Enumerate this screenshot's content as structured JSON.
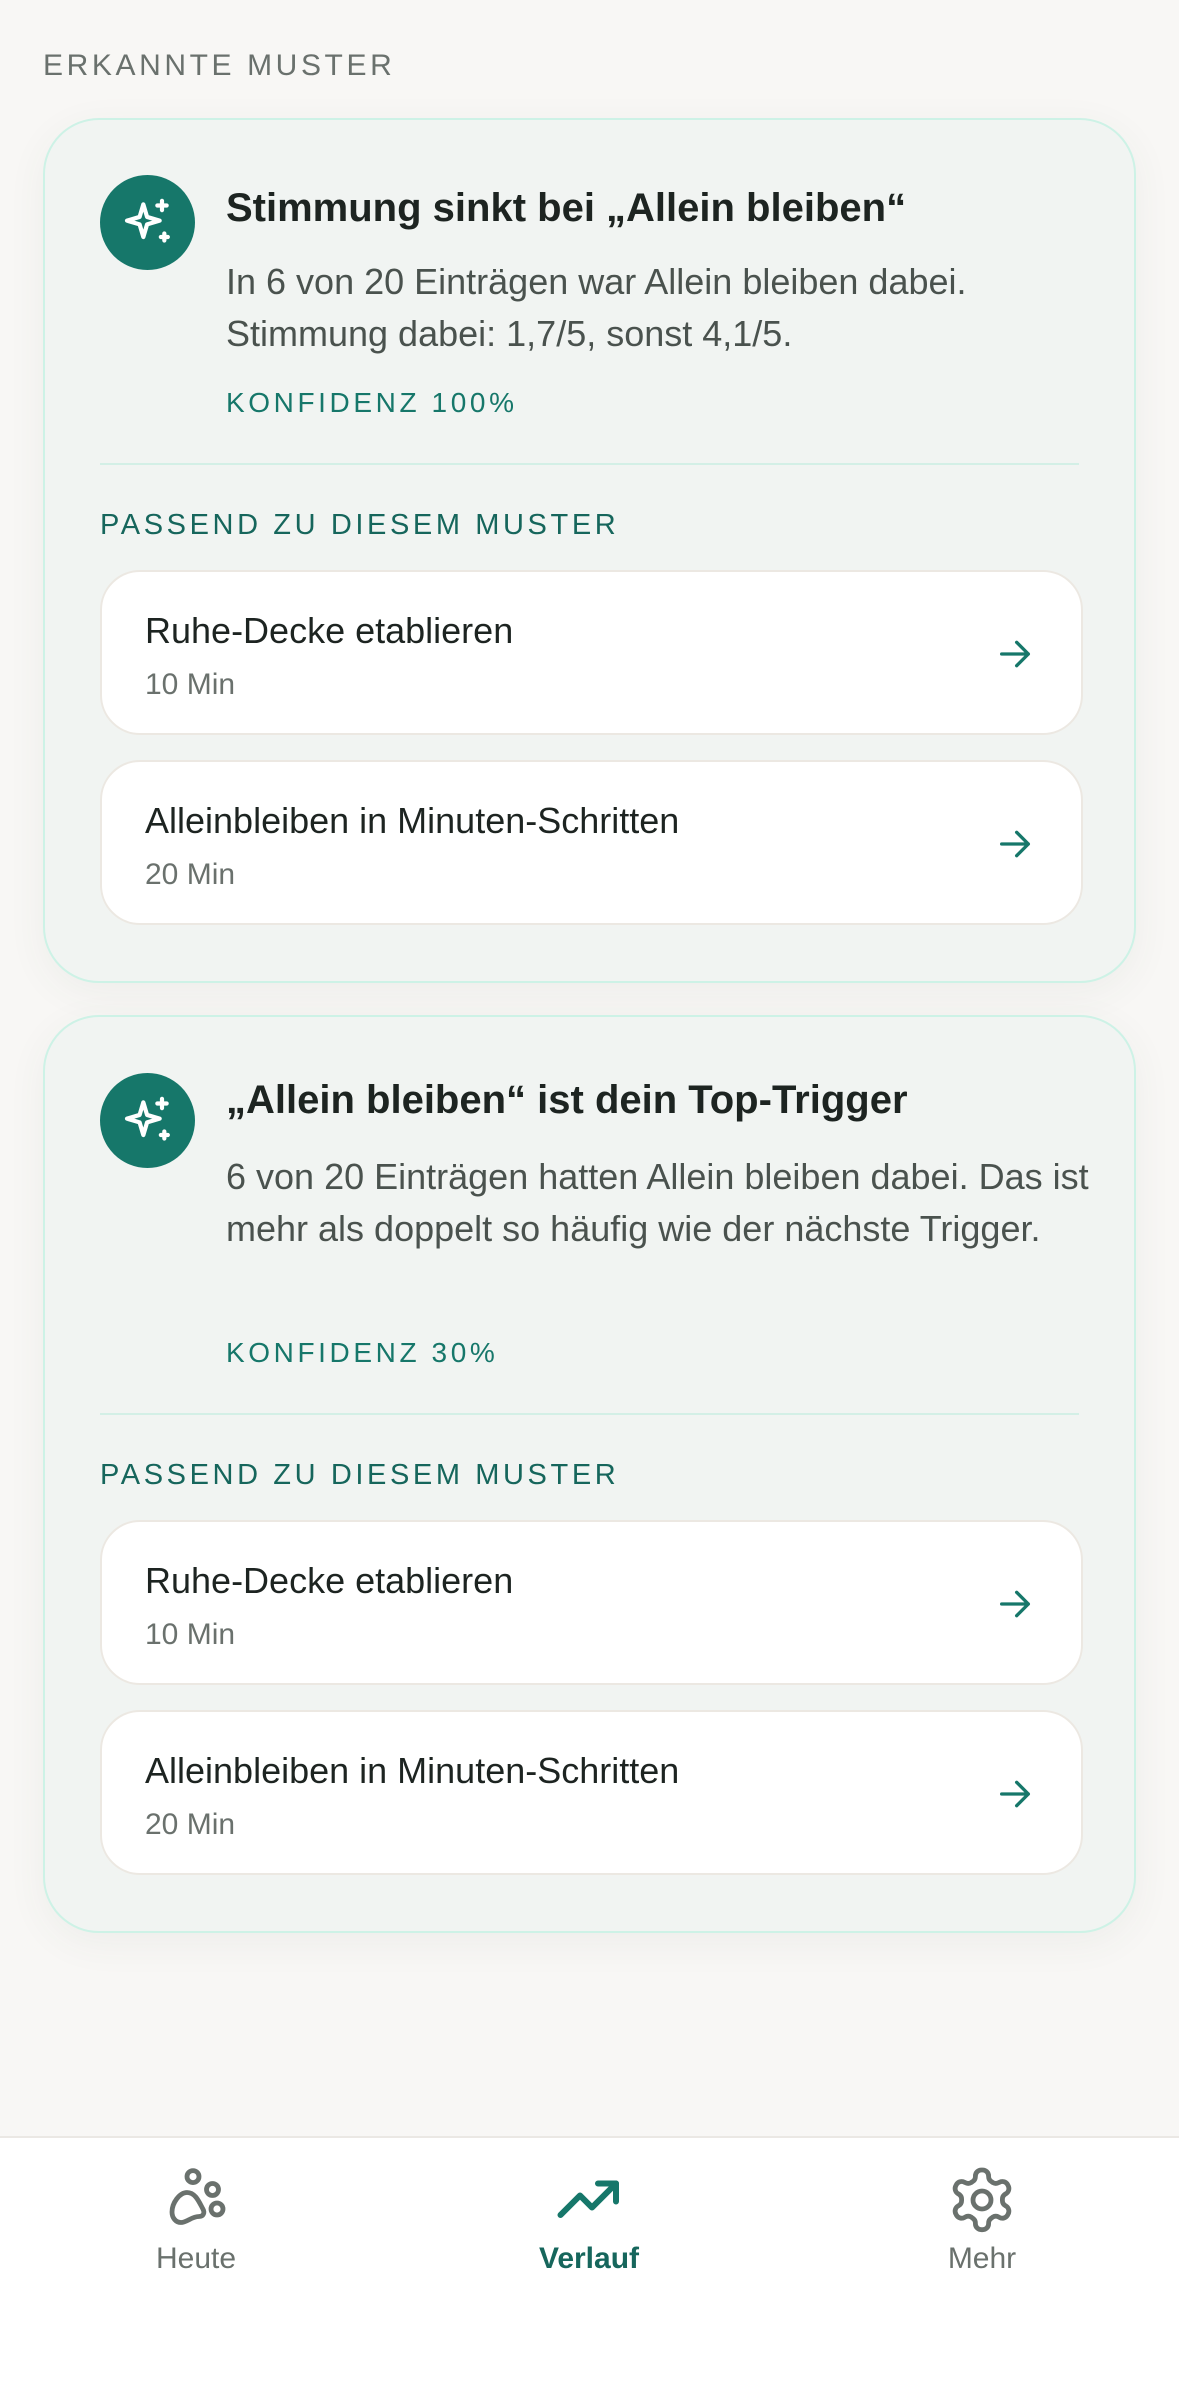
{
  "section": {
    "title": "ERKANNTE MUSTER"
  },
  "patterns": [
    {
      "icon": "sparkles-icon",
      "title": "Stimmung sinkt bei „Allein bleiben“",
      "description": "In 6 von 20 Einträgen war Allein bleiben dabei. Stimmung dabei: 1,7/5, sonst 4,1/5.",
      "confidence": "KONFIDENZ 100%",
      "match_label": "PASSEND ZU DIESEM MUSTER",
      "items": [
        {
          "name": "Ruhe-Decke etablieren",
          "duration": "10 Min"
        },
        {
          "name": "Alleinbleiben in Minuten-Schritten",
          "duration": "20 Min"
        }
      ]
    },
    {
      "icon": "sparkles-icon",
      "title": "„Allein bleiben“ ist dein Top-Trigger",
      "description": "6 von 20 Einträgen hatten Allein bleiben dabei. Das ist mehr als doppelt so häufig wie der nächste Trigger.",
      "confidence": "KONFIDENZ 30%",
      "match_label": "PASSEND ZU DIESEM MUSTER",
      "items": [
        {
          "name": "Ruhe-Decke etablieren",
          "duration": "10 Min"
        },
        {
          "name": "Alleinbleiben in Minuten-Schritten",
          "duration": "20 Min"
        }
      ]
    }
  ],
  "tabbar": {
    "tabs": [
      {
        "label": "Heute",
        "icon": "paw-icon",
        "active": false
      },
      {
        "label": "Verlauf",
        "icon": "trending-up-icon",
        "active": true
      },
      {
        "label": "Mehr",
        "icon": "gear-icon",
        "active": false
      }
    ]
  },
  "colors": {
    "accent": "#16776a",
    "background": "#f8f7f5",
    "card": "#f1f4f2",
    "card_border": "#cdf2e6"
  }
}
